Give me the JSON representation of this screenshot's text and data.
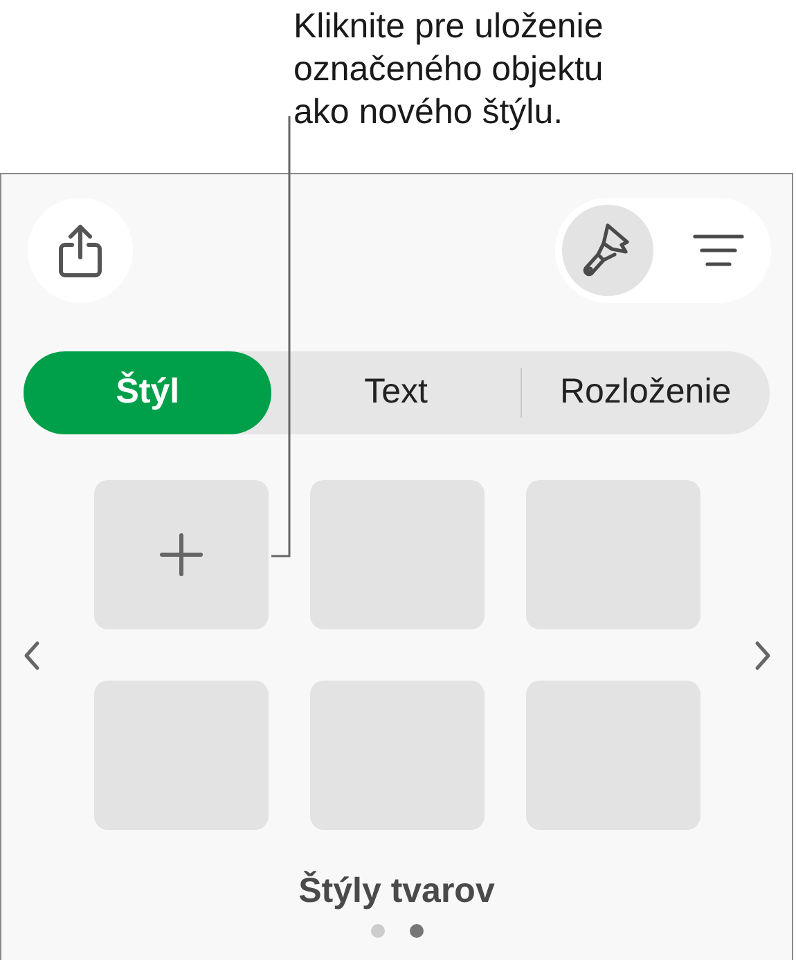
{
  "callout": "Kliknite pre uloženie označeného objektu ako nového štýlu.",
  "toolbar": [
    {
      "kind": "brush",
      "selected": true
    },
    {
      "kind": "format",
      "selected": false
    }
  ],
  "tabs": [
    {
      "label": "Štýl",
      "selected": true
    },
    {
      "label": "Text",
      "selected": false
    },
    {
      "label": "Rozloženie",
      "selected": false
    }
  ],
  "tiles": [
    {
      "kind": "add"
    },
    {
      "kind": "empty"
    },
    {
      "kind": "empty"
    },
    {
      "kind": "empty"
    },
    {
      "kind": "empty"
    },
    {
      "kind": "empty"
    }
  ],
  "title": "Štýly tvarov",
  "pages": [
    {
      "selected": false
    },
    {
      "selected": true
    }
  ]
}
